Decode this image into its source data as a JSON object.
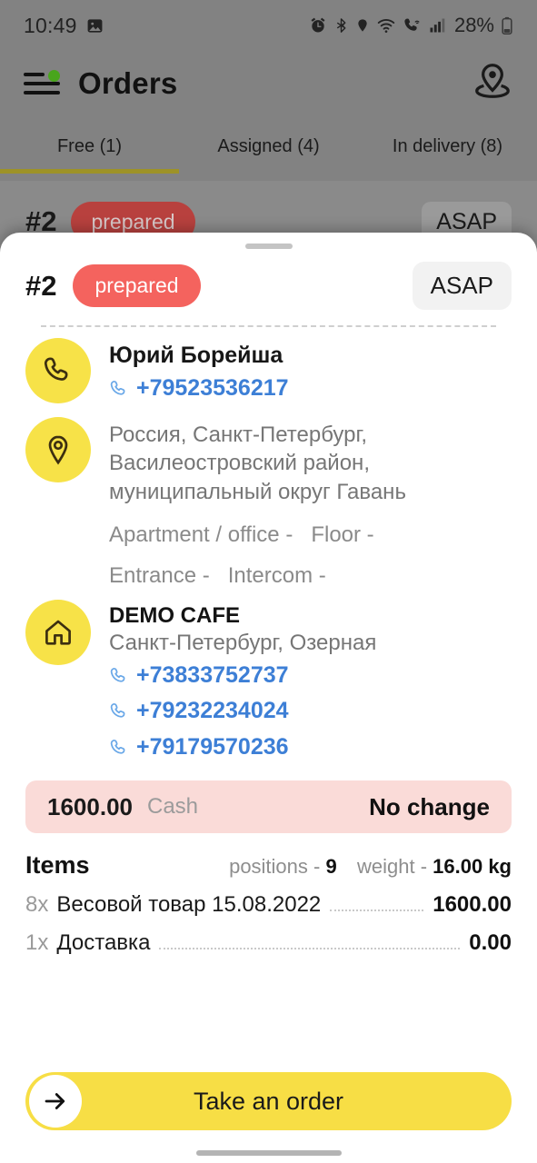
{
  "status_bar": {
    "time": "10:49",
    "battery_percent": "28%",
    "icons": [
      "image-icon",
      "alarm-icon",
      "bluetooth-icon",
      "location-icon",
      "wifi-icon",
      "wifi-calling-icon",
      "signal-icon",
      "battery-icon"
    ]
  },
  "app_bar": {
    "title": "Orders",
    "menu_icon": "hamburger-menu-icon",
    "menu_badge": "notification-dot",
    "right_icon": "map-pin-icon"
  },
  "tabs": [
    {
      "label": "Free (1)",
      "active": true
    },
    {
      "label": "Assigned (4)",
      "active": false
    },
    {
      "label": "In delivery (8)",
      "active": false
    }
  ],
  "background_card": {
    "order_number": "#2",
    "status": "prepared",
    "time_label": "ASAP"
  },
  "sheet": {
    "order_number": "#2",
    "status": "prepared",
    "time_label": "ASAP",
    "customer": {
      "name": "Юрий Борейша",
      "phone": "+79523536217"
    },
    "address": {
      "full": "Россия, Санкт-Петербург, Василеостровский район, муниципальный округ Гавань",
      "apartment": "Apartment / office -",
      "floor": "Floor -",
      "entrance": "Entrance -",
      "intercom": "Intercom -"
    },
    "restaurant": {
      "name": "DEMO CAFE",
      "address": "Санкт-Петербург, Озерная",
      "phones": [
        "+73833752737",
        "+79232234024",
        "+79179570236"
      ]
    },
    "payment": {
      "amount": "1600.00",
      "method": "Cash",
      "change": "No change"
    },
    "items_header": {
      "title": "Items",
      "positions_label": "positions -",
      "positions_value": "9",
      "weight_label": "weight -",
      "weight_value": "16.00 kg"
    },
    "items": [
      {
        "qty": "8x",
        "name": "Весовой товар 15.08.2022",
        "price": "1600.00"
      },
      {
        "qty": "1x",
        "name": "Доставка",
        "price": "0.00"
      }
    ],
    "cta": {
      "label": "Take an order",
      "icon": "arrow-right-icon"
    }
  },
  "colors": {
    "accent_yellow": "#f7de45",
    "status_red": "#f4635e",
    "phone_blue": "#3d7fd6",
    "payment_bg": "#fadbd8",
    "tab_indicator": "#9d9227",
    "badge_green": "#49a51c"
  }
}
